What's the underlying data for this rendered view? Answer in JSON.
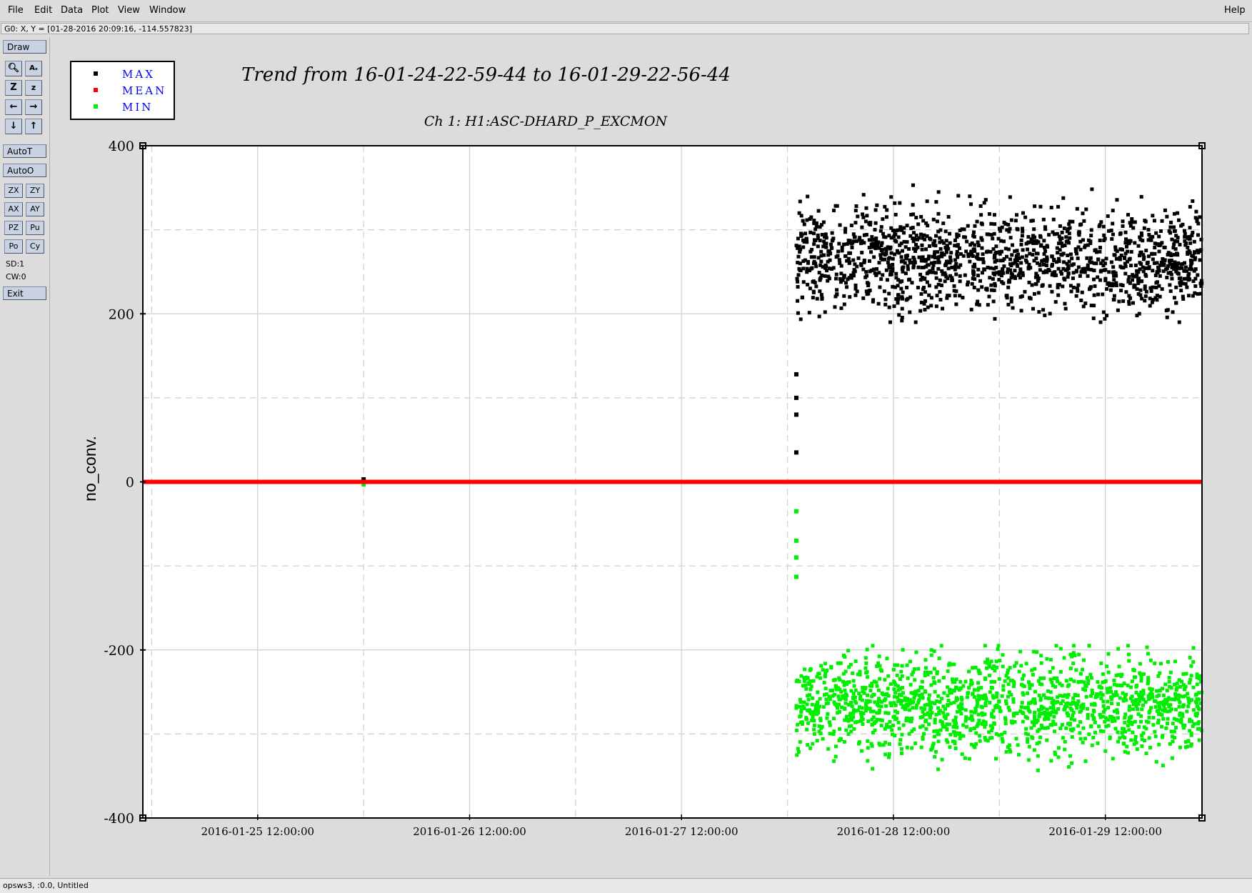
{
  "menu": {
    "items": [
      "File",
      "Edit",
      "Data",
      "Plot",
      "View",
      "Window"
    ],
    "help": "Help"
  },
  "status_line": "G0: X, Y = [01-28-2016 20:09:16, -114.557823]",
  "toolbar": {
    "draw": "Draw",
    "auto_t": "AutoT",
    "auto_o": "AutoO",
    "zx": "ZX",
    "zy": "ZY",
    "ax": "AX",
    "ay": "AY",
    "pz": "PZ",
    "pu": "Pu",
    "po": "Po",
    "cy": "Cy",
    "sd": "SD:1",
    "cw": "CW:0",
    "exit": "Exit"
  },
  "footer": "opsws3, :0.0, Untitled",
  "colors": {
    "max": "#000000",
    "mean": "#ff0000",
    "min": "#00ee00",
    "legend_text": "#0000ff"
  },
  "chart_data": {
    "type": "scatter",
    "title": "Trend from 16-01-24-22-59-44 to 16-01-29-22-56-44",
    "subtitle": "Ch 1: H1:ASC-DHARD_P_EXCMON",
    "xlabel": "",
    "ylabel": "no_conv.",
    "x_range": [
      "2016-01-24 22:59:44",
      "2016-01-29 22:56:44"
    ],
    "xticks": [
      "2016-01-25 12:00:00",
      "2016-01-26 12:00:00",
      "2016-01-27 12:00:00",
      "2016-01-28 12:00:00",
      "2016-01-29 12:00:00"
    ],
    "ylim": [
      -400,
      400
    ],
    "yticks": [
      "400",
      "200",
      "0",
      "-200",
      "-400"
    ],
    "grid": true,
    "legend_position": "top-left",
    "legend": [
      "MAX",
      "MEAN",
      "MIN"
    ],
    "series": [
      {
        "name": "MAX",
        "color": "#000000",
        "segments": [
          {
            "x_start": "2016-01-24 22:59:44",
            "x_end": "2016-01-28 01:00:00",
            "y": 0
          },
          {
            "x_start": "2016-01-28 01:00:00",
            "x_end": "2016-01-29 22:56:44",
            "y_center": 265,
            "y_min": 190,
            "y_max": 390
          }
        ],
        "points": [
          {
            "x": "2016-01-26 00:00:00",
            "y": 3
          },
          {
            "x": "2016-01-28 01:00:00",
            "y": 128
          },
          {
            "x": "2016-01-28 01:00:00",
            "y": 100
          },
          {
            "x": "2016-01-28 01:00:00",
            "y": 80
          },
          {
            "x": "2016-01-28 01:00:00",
            "y": 35
          }
        ]
      },
      {
        "name": "MEAN",
        "color": "#ff0000",
        "segments": [
          {
            "x_start": "2016-01-24 22:59:44",
            "x_end": "2016-01-29 22:56:44",
            "y": 0
          }
        ]
      },
      {
        "name": "MIN",
        "color": "#00ee00",
        "segments": [
          {
            "x_start": "2016-01-24 22:59:44",
            "x_end": "2016-01-28 01:00:00",
            "y": 0
          },
          {
            "x_start": "2016-01-28 01:00:00",
            "x_end": "2016-01-29 22:56:44",
            "y_center": -265,
            "y_min": -390,
            "y_max": -195
          }
        ],
        "points": [
          {
            "x": "2016-01-26 00:00:00",
            "y": -3
          },
          {
            "x": "2016-01-28 01:00:00",
            "y": -35
          },
          {
            "x": "2016-01-28 01:00:00",
            "y": -70
          },
          {
            "x": "2016-01-28 01:00:00",
            "y": -90
          },
          {
            "x": "2016-01-28 01:00:00",
            "y": -113
          }
        ]
      }
    ]
  }
}
